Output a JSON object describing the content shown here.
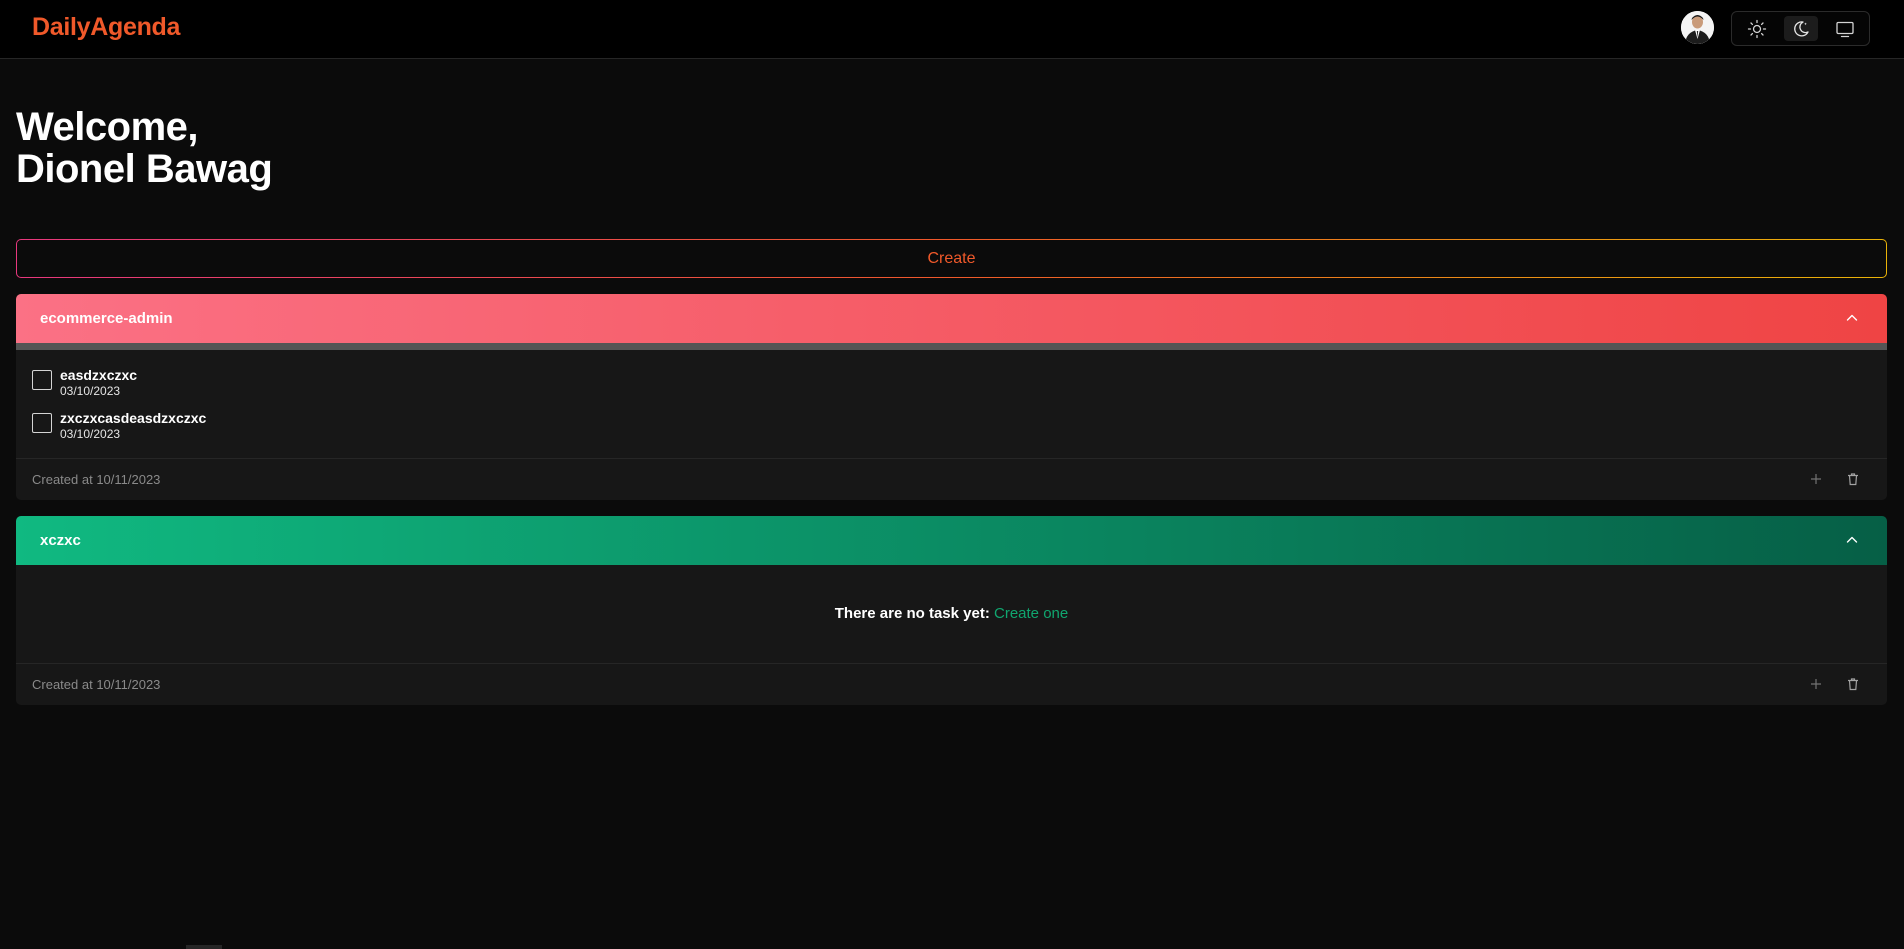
{
  "app": {
    "brand": "DailyAgenda",
    "brand_color": "#f0592a"
  },
  "header": {
    "avatar_alt": "user-avatar",
    "theme": {
      "options": [
        {
          "name": "light",
          "icon": "sun-icon"
        },
        {
          "name": "dark",
          "icon": "moon-icon",
          "active": true
        },
        {
          "name": "system",
          "icon": "monitor-icon"
        }
      ]
    }
  },
  "welcome": {
    "line1": "Welcome,",
    "line2": "Dionel Bawag"
  },
  "create_button": {
    "label": "Create"
  },
  "agendas": [
    {
      "title": "ecommerce-admin",
      "gradient": [
        "#fb7185",
        "#ef4444"
      ],
      "progress": 0,
      "tasks": [
        {
          "name": "easdzxczxc",
          "date": "03/10/2023",
          "done": false
        },
        {
          "name": "zxczxcasdeasdzxczxc",
          "date": "03/10/2023",
          "done": false
        }
      ],
      "created": "Created at 10/11/2023"
    },
    {
      "title": "xczxc",
      "gradient": [
        "#10b981",
        "#065f46"
      ],
      "tasks": [],
      "empty_text": "There are no task yet:",
      "empty_link": "Create one",
      "created": "Created at 10/11/2023"
    }
  ]
}
